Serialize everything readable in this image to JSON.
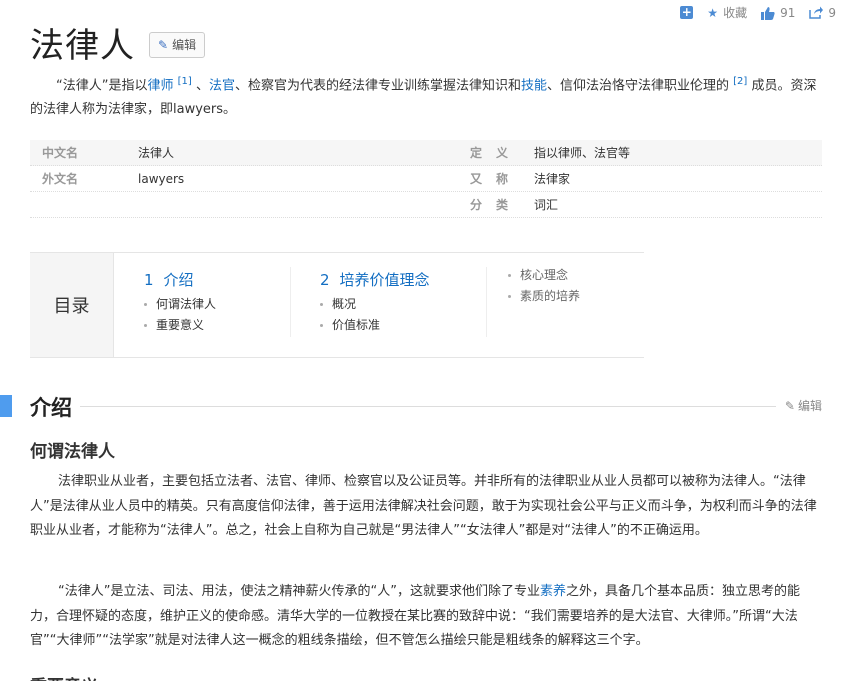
{
  "toolbar": {
    "add_icon": "plus-square-icon",
    "favorite_label": "收藏",
    "like_count": "91",
    "share_count": "9"
  },
  "title": "法律人",
  "edit_label": "编辑",
  "summary": {
    "part1": "“法律人”是指以",
    "link_lawyer": "律师",
    "ref1": "[1]",
    "sep1": " 、",
    "link_judge": "法官",
    "part2": "、检察官为代表的经法律专业训练掌握法律知识和",
    "link_skill": "技能",
    "part3": "、信仰法治恪守法律职业伦理的",
    "ref2": "[2]",
    "part4": " 成员。资深的法律人称为法律家，即lawyers。"
  },
  "info": {
    "rows": [
      {
        "l1": "中文名",
        "v1": "法律人",
        "l2": "定义",
        "v2": "指以律师、法官等"
      },
      {
        "l1": "外文名",
        "v1": "lawyers",
        "l2": "又称",
        "v2": "法律家"
      },
      {
        "l1": "",
        "v1": "",
        "l2": "分类",
        "v2": "词汇"
      }
    ]
  },
  "toc": {
    "label": "目录",
    "s1": {
      "num": "1",
      "title": "介绍",
      "items": [
        "何谓法律人",
        "重要意义"
      ]
    },
    "s2": {
      "num": "2",
      "title": "培养价值理念",
      "items": [
        "概况",
        "价值标准"
      ]
    },
    "s3": {
      "items": [
        "核心理念",
        "素质的培养"
      ]
    }
  },
  "section": {
    "title": "介绍",
    "edit_label": "编辑",
    "subtitle": "何谓法律人",
    "p1": "法律职业从业者，主要包括立法者、法官、律师、检察官以及公证员等。并非所有的法律职业从业人员都可以被称为法律人。“法律人”是法律从业人员中的精英。只有高度信仰法律，善于运用法律解决社会问题，敢于为实现社会公平与正义而斗争，为权利而斗争的法律职业从业者，才能称为“法律人”。总之，社会上自称为自己就是“男法律人”“女法律人”都是对“法律人”的不正确运用。",
    "p2a": "“法律人”是立法、司法、用法，使法之精神薪火传承的“人”，这就要求他们除了专业",
    "p2_link": "素养",
    "p2b": "之外，具备几个基本品质：独立思考的能力，合理怀疑的态度，维护正义的使命感。清华大学的一位教授在某比赛的致辞中说：“我们需要培养的是大法官、大律师。”所谓“大法官”“大律师”“法学家”就是对法律人这一概念的粗线条描绘，但不管怎么描绘只能是粗线条的解释这三个字。",
    "next_subtitle": "重要意义"
  }
}
